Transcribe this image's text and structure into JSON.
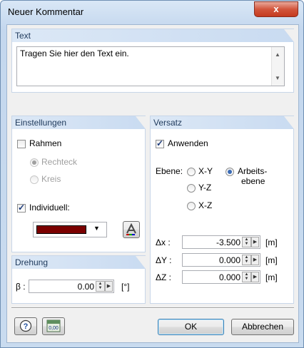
{
  "window": {
    "title": "Neuer Kommentar",
    "close_glyph": "x"
  },
  "text_group": {
    "header": "Text",
    "value": "Tragen Sie hier den Text ein."
  },
  "settings": {
    "header": "Einstellungen",
    "rahmen": {
      "label": "Rahmen",
      "checked": false
    },
    "shape_options": [
      {
        "label": "Rechteck",
        "selected": true,
        "enabled": false
      },
      {
        "label": "Kreis",
        "selected": false,
        "enabled": false
      }
    ],
    "individuell": {
      "label": "Individuell:",
      "checked": true
    },
    "color": "#7b0000",
    "color_button_icon": "text-color-icon"
  },
  "rotation": {
    "header": "Drehung",
    "label": "β :",
    "value": "0.00",
    "unit": "[°]"
  },
  "offset": {
    "header": "Versatz",
    "anwenden": {
      "label": "Anwenden",
      "checked": true
    },
    "plane_label": "Ebene:",
    "planes": [
      "X-Y",
      "Y-Z",
      "X-Z"
    ],
    "work_plane": {
      "line1": "Arbeits-",
      "line2": "ebene",
      "selected": true
    },
    "dx": {
      "label": "Δx :",
      "value": "-3.500",
      "unit": "[m]"
    },
    "dy": {
      "label": "ΔY :",
      "value": "0.000",
      "unit": "[m]"
    },
    "dz": {
      "label": "ΔZ :",
      "value": "0.000",
      "unit": "[m]"
    }
  },
  "footer": {
    "help_icon": "help-icon",
    "units_icon": "units-icon",
    "units_text": "0,00",
    "ok_label": "OK",
    "cancel_label": "Abbrechen"
  }
}
